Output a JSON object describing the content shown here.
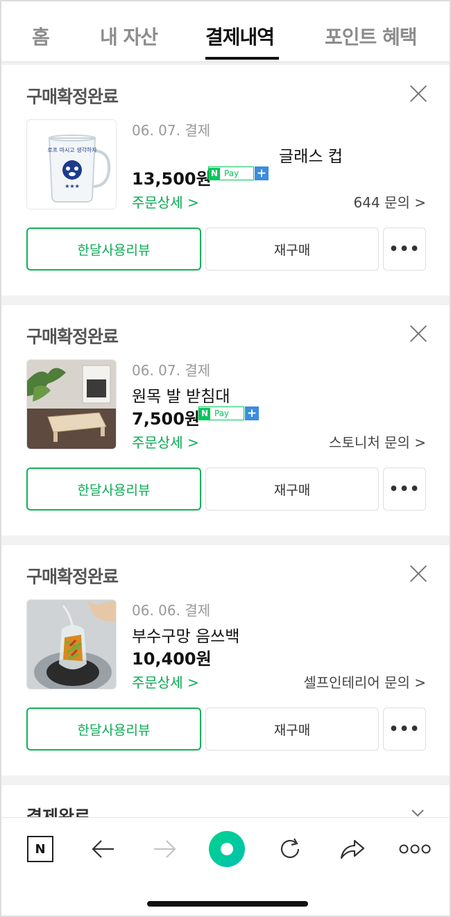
{
  "tabs": [
    {
      "label": "홈"
    },
    {
      "label": "내 자산"
    },
    {
      "label": "결제내역"
    },
    {
      "label": "포인트 혜택"
    }
  ],
  "orders": [
    {
      "status": "구매확정완료",
      "date": "06. 07. 결제",
      "name": "글래스 컵",
      "price": "13,500원",
      "npay": true,
      "detail": "주문상세 >",
      "inquiry": "644 문의 >",
      "review_label": "한달사용리뷰",
      "rebuy_label": "재구매",
      "more_label": "•••",
      "thumb_text": "로프 마시고 생각하자"
    },
    {
      "status": "구매확정완료",
      "date": "06. 07. 결제",
      "name": "원목 발 받침대",
      "price": "7,500원",
      "npay": true,
      "detail": "주문상세 >",
      "inquiry": "스토니처 문의 >",
      "review_label": "한달사용리뷰",
      "rebuy_label": "재구매",
      "more_label": "•••"
    },
    {
      "status": "구매확정완료",
      "date": "06. 06. 결제",
      "name": "부수구망 음쓰백",
      "price": "10,400원",
      "npay": false,
      "detail": "주문상세 >",
      "inquiry": "셀프인테리어 문의 >",
      "review_label": "한달사용리뷰",
      "rebuy_label": "재구매",
      "more_label": "•••"
    }
  ],
  "partial_card": {
    "status": "결제완료"
  },
  "npay_badge": {
    "n": "N",
    "pay": "Pay",
    "plus": "+"
  },
  "toolbar": {
    "icons": [
      "naver-n-icon",
      "back-arrow-icon",
      "forward-arrow-icon",
      "green-home-icon",
      "refresh-icon",
      "share-icon",
      "more-dots-icon"
    ],
    "n_label": "N"
  },
  "colors": {
    "accent_green": "#03c75a",
    "text_green": "#0aab52",
    "pay_blue": "#3a8de0"
  }
}
